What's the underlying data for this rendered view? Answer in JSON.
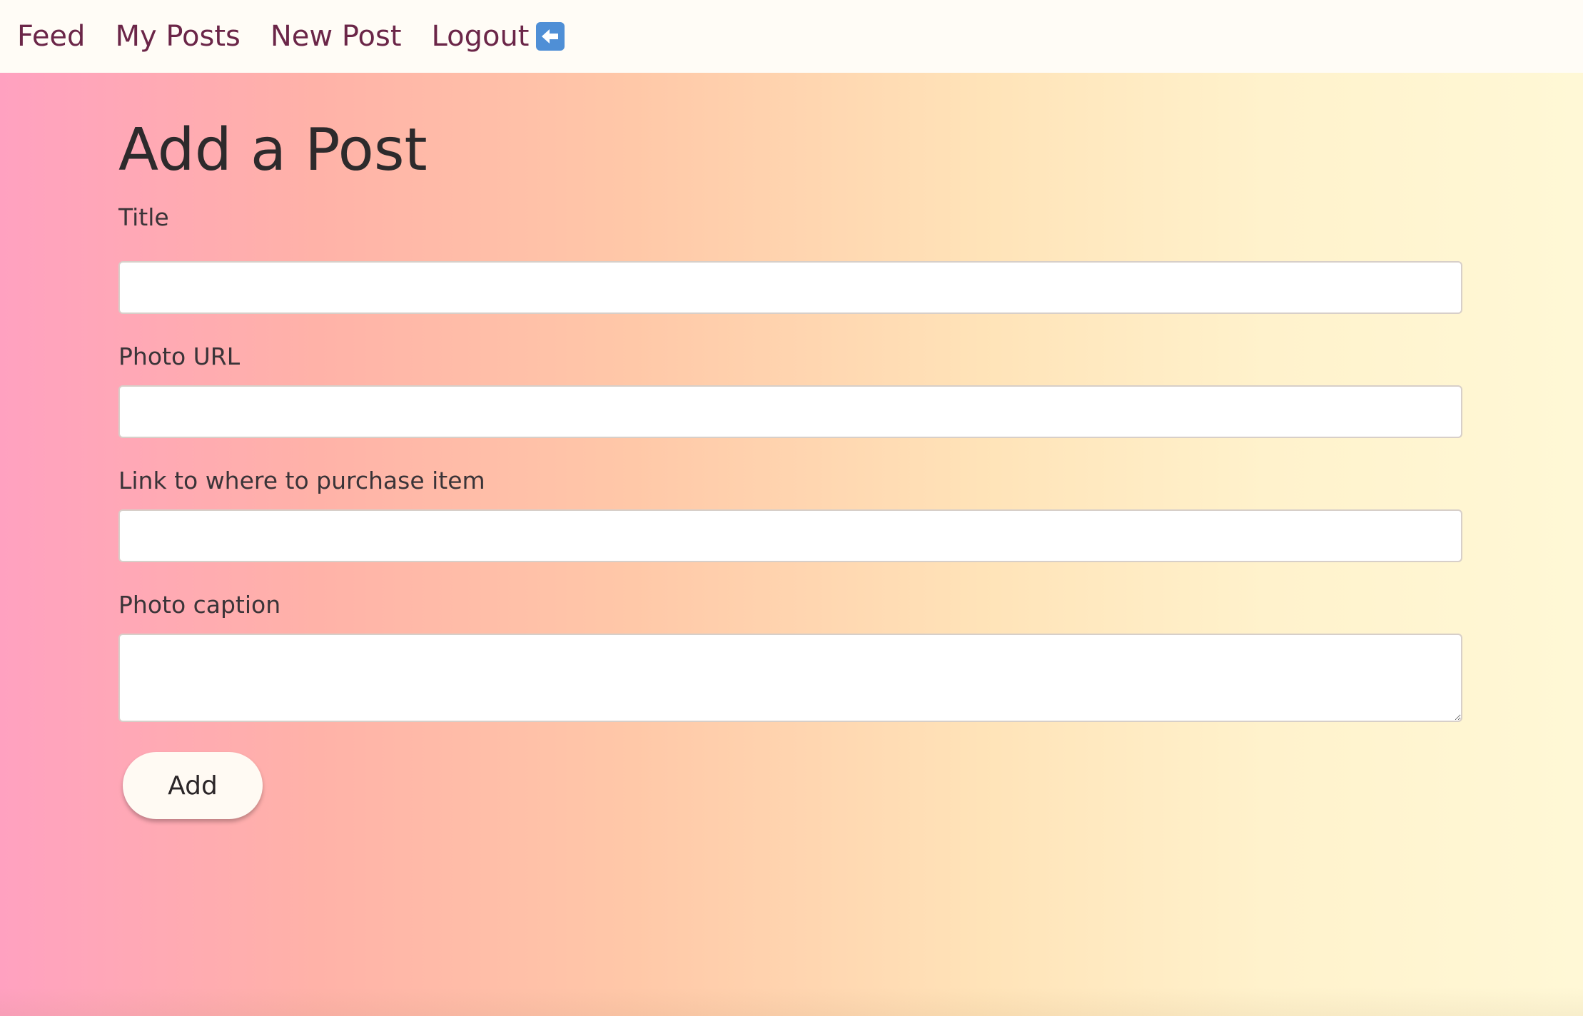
{
  "nav": {
    "items": [
      {
        "label": "Feed"
      },
      {
        "label": "My Posts"
      },
      {
        "label": "New Post"
      },
      {
        "label": "Logout"
      }
    ],
    "logout_icon": "left-arrow-icon"
  },
  "page": {
    "title": "Add a Post"
  },
  "form": {
    "title_label": "Title",
    "title_value": "",
    "photo_url_label": "Photo URL",
    "photo_url_value": "",
    "purchase_link_label": "Link to where to purchase item",
    "purchase_link_value": "",
    "caption_label": "Photo caption",
    "caption_value": "",
    "submit_label": "Add"
  },
  "colors": {
    "nav_text": "#6b2648",
    "gradient_start": "#ffa1c0",
    "gradient_end": "#fff8d6",
    "nav_bg": "#fffcf6"
  }
}
